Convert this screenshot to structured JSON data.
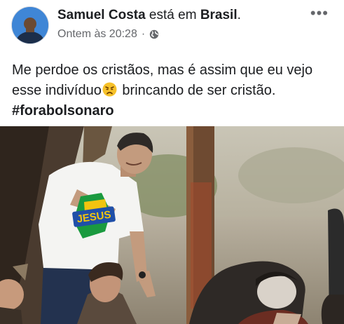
{
  "post": {
    "author": "Samuel Costa",
    "verb": " está em ",
    "location": "Brasil",
    "location_suffix": ".",
    "timestamp": "Ontem às 20:28",
    "separator": "·",
    "more_label": "•••",
    "text_part1": "Me perdoe os cristãos, mas é assim que eu vejo esse indivíduo",
    "text_part2": " brincando de ser cristão. ",
    "hashtag": "#forabolsonaro",
    "shirt_text": "JESUS"
  },
  "icons": {
    "globe": "globe-icon",
    "emoji": "weary-face-icon",
    "more": "more-options-icon"
  },
  "colors": {
    "text": "#1c1e21",
    "meta": "#65676b",
    "shirt_yellow": "#f2c40f",
    "shirt_green": "#1a9a3f",
    "shirt_blue": "#1f4fa8"
  }
}
